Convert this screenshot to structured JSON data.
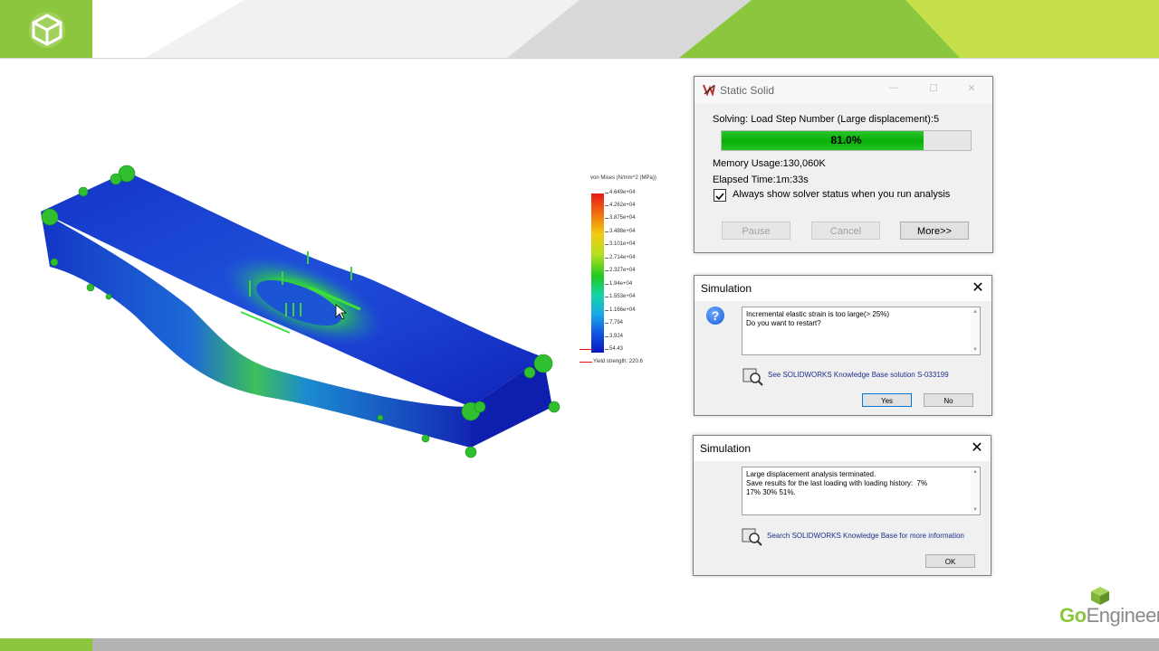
{
  "brand": {
    "name_prefix": "Go",
    "name_suffix": "Engineer",
    "accent_color": "#8cc63f"
  },
  "legend": {
    "title": "von Mises (N/mm^2 (MPa))",
    "ticks": [
      "4.649e+04",
      "4.262e+04",
      "3.875e+04",
      "3.488e+04",
      "3.101e+04",
      "2.714e+04",
      "2.327e+04",
      "1.94e+04",
      "1.553e+04",
      "1.166e+04",
      "7,794",
      "3,924",
      "54.43"
    ],
    "yield_label": "Yield strength: 220.6"
  },
  "static_solid": {
    "title": "Static Solid",
    "minimize": "—",
    "maximize": "☐",
    "close": "✕",
    "solving": "Solving:  Load Step Number (Large displacement):5",
    "progress_pct": 0.81,
    "progress_label": "81.0%",
    "memory": "Memory Usage:130,060K",
    "elapsed": "Elapsed Time:1m:33s",
    "checkbox_checked": true,
    "checkbox_label": "Always show solver status when you run analysis",
    "pause": "Pause",
    "cancel": "Cancel",
    "more": "More>>"
  },
  "sim1": {
    "title": "Simulation",
    "close": "✕",
    "message": "Incremental elastic strain is too large(> 25%)\nDo you want to restart?",
    "link": "See SOLIDWORKS Knowledge Base solution S-033199",
    "yes": "Yes",
    "no": "No"
  },
  "sim2": {
    "title": "Simulation",
    "close": "✕",
    "message": "Large displacement analysis terminated.\nSave results for the last loading with loading history:  7%\n17% 30% 51%.",
    "link": "Search SOLIDWORKS Knowledge Base for more information",
    "ok": "OK"
  }
}
